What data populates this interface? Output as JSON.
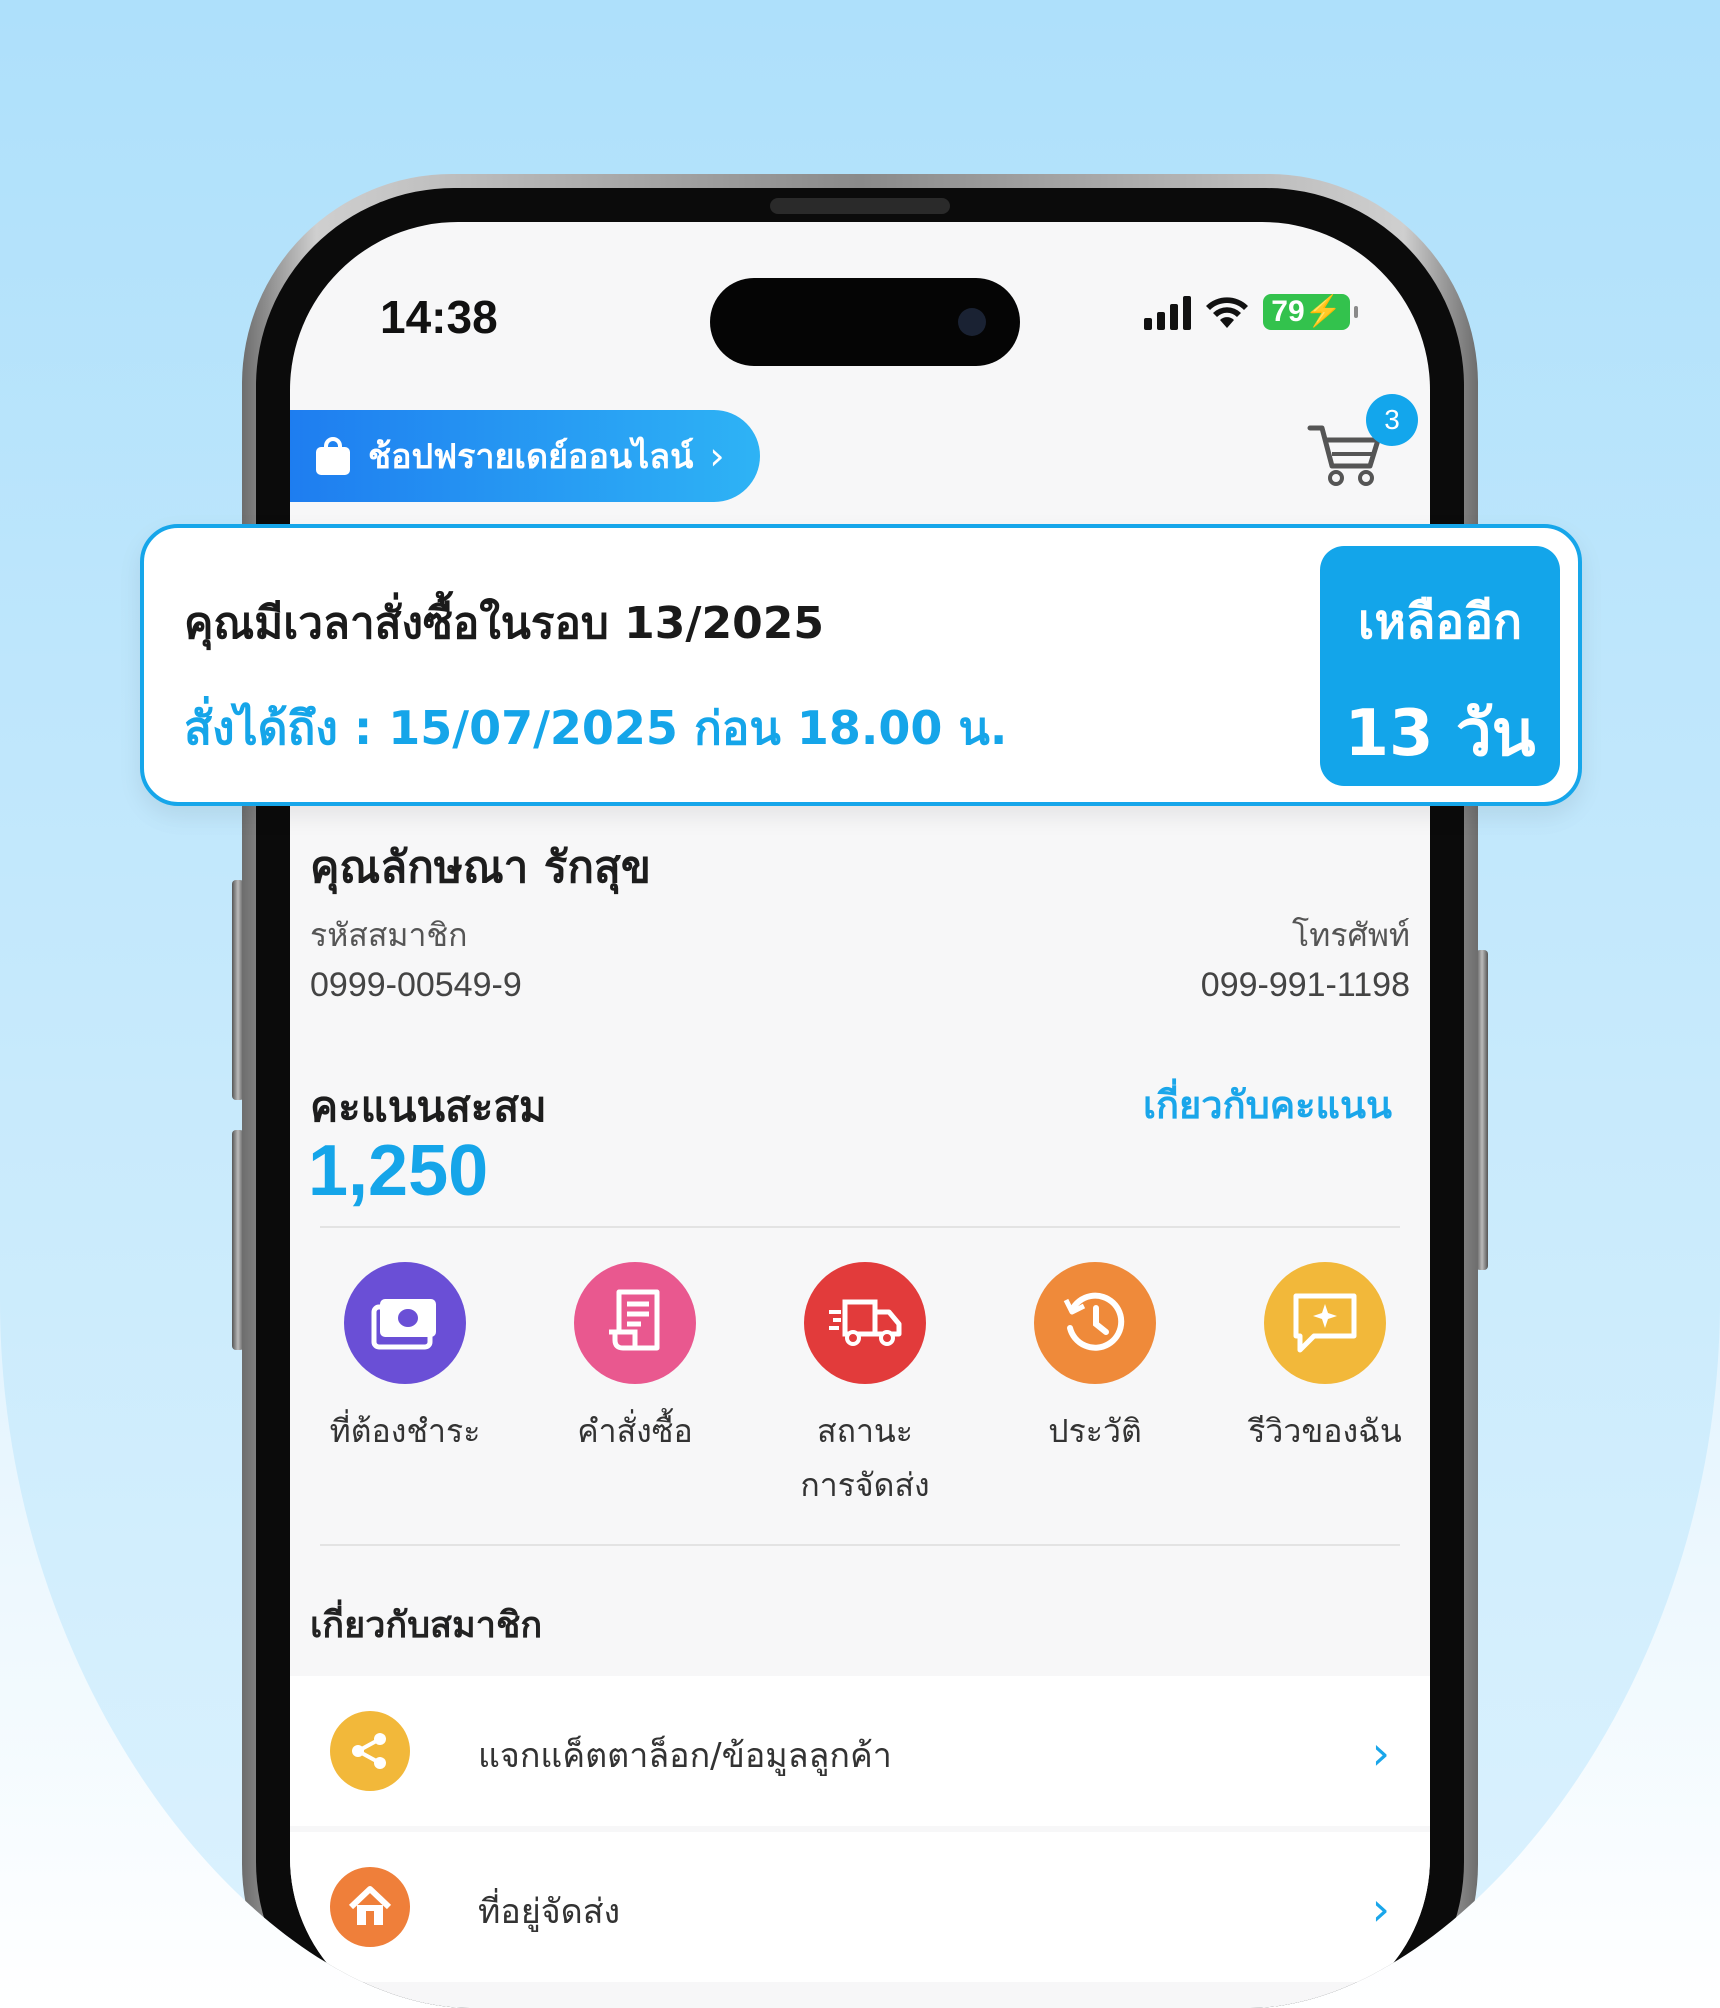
{
  "status_bar": {
    "time": "14:38",
    "battery": "79"
  },
  "header": {
    "shop_button": "ช้อปฟรายเดย์ออนไลน์",
    "cart_count": "3"
  },
  "promo": {
    "title": "คุณมีเวลาสั่งซื้อในรอบ 13/2025",
    "deadline": "สั่งได้ถึง : 15/07/2025 ก่อน 18.00 น.",
    "badge_line1": "เหลืออีก",
    "badge_line2": "13 วัน"
  },
  "profile": {
    "name": "คุณลักษณา รักสุข",
    "member_id_label": "รหัสสมาชิก",
    "member_id": "0999-00549-9",
    "phone_label": "โทรศัพท์",
    "phone": "099-991-1198"
  },
  "points": {
    "label": "คะแนนสะสม",
    "link": "เกี่ยวกับคะแนน",
    "value": "1,250"
  },
  "actions": [
    {
      "label": "ที่ต้องชำระ",
      "icon": "money-icon",
      "color": "#6a4fd6"
    },
    {
      "label": "คำสั่งซื้อ",
      "icon": "receipt-icon",
      "color": "#e9588f"
    },
    {
      "label": "สถานะ\nการจัดส่ง",
      "icon": "truck-icon",
      "color": "#e23b3b"
    },
    {
      "label": "ประวัติ",
      "icon": "history-icon",
      "color": "#ef8a3a"
    },
    {
      "label": "รีวิวของฉัน",
      "icon": "review-icon",
      "color": "#f2b83a"
    }
  ],
  "member_section": {
    "title": "เกี่ยวกับสมาชิก",
    "items": [
      {
        "label": "แจกแค็ตตาล็อก/ข้อมูลลูกค้า",
        "icon": "share-icon",
        "color": "#f2b83a"
      },
      {
        "label": "ที่อยู่จัดส่ง",
        "icon": "home-icon",
        "color": "#ef7f3a"
      }
    ]
  }
}
